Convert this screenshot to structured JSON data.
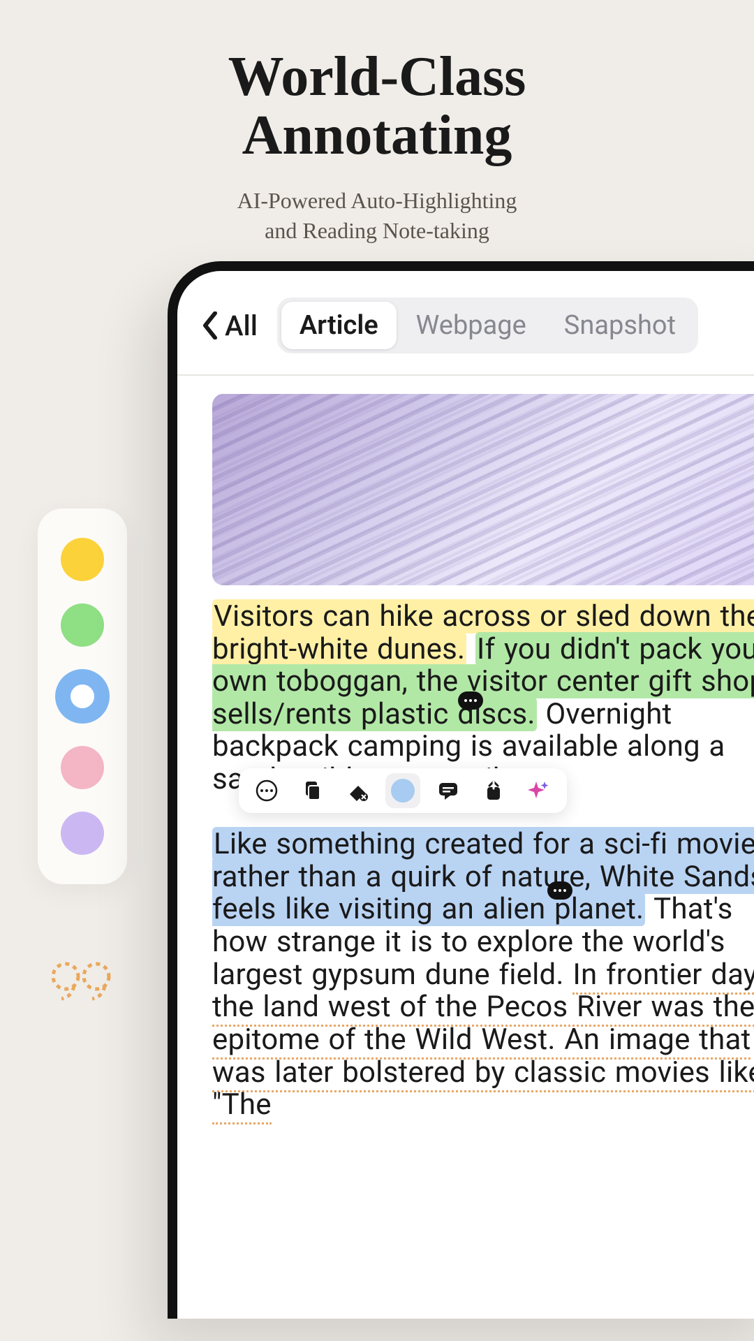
{
  "hero": {
    "title_line1": "World-Class",
    "title_line2": "Annotating",
    "subtitle_line1": "AI-Powered Auto-Highlighting",
    "subtitle_line2": "and Reading Note-taking"
  },
  "palette": {
    "colors": [
      {
        "name": "yellow",
        "hex": "#fcd23a"
      },
      {
        "name": "green",
        "hex": "#8fdf84"
      },
      {
        "name": "blue",
        "hex": "#7fb6f2",
        "selected": true
      },
      {
        "name": "pink",
        "hex": "#f4b5c4"
      },
      {
        "name": "purple",
        "hex": "#cbb8f3"
      }
    ]
  },
  "nav": {
    "back_label": "All",
    "tabs": [
      {
        "label": "Article",
        "active": true
      },
      {
        "label": "Webpage"
      },
      {
        "label": "Snapshot"
      }
    ]
  },
  "article": {
    "seg_yellow": "Visitors can hike across or sled down the bright-white dunes.",
    "seg_green": "If you didn't pack your own toboggan, the visitor center gift shop sells/rents plastic discs.",
    "seg_plain1": " Overnight backpack camping is available along a sandy wilderness trail.",
    "seg_blue": "Like something created for a sci-fi movie rather than a quirk of nature, White Sands feels like visiting an alien planet.",
    "seg_plain2": " That's how strange it is to explore the world's largest gypsum dune field. ",
    "seg_orange": "In frontier days, the land west of the Pecos River was the epitome of the Wild West. An image that was later bolstered by classic movies like \"The"
  },
  "toolbar": {
    "icons": [
      "more",
      "copy",
      "erase",
      "highlight-color",
      "comment",
      "share",
      "ai-sparkle"
    ]
  }
}
